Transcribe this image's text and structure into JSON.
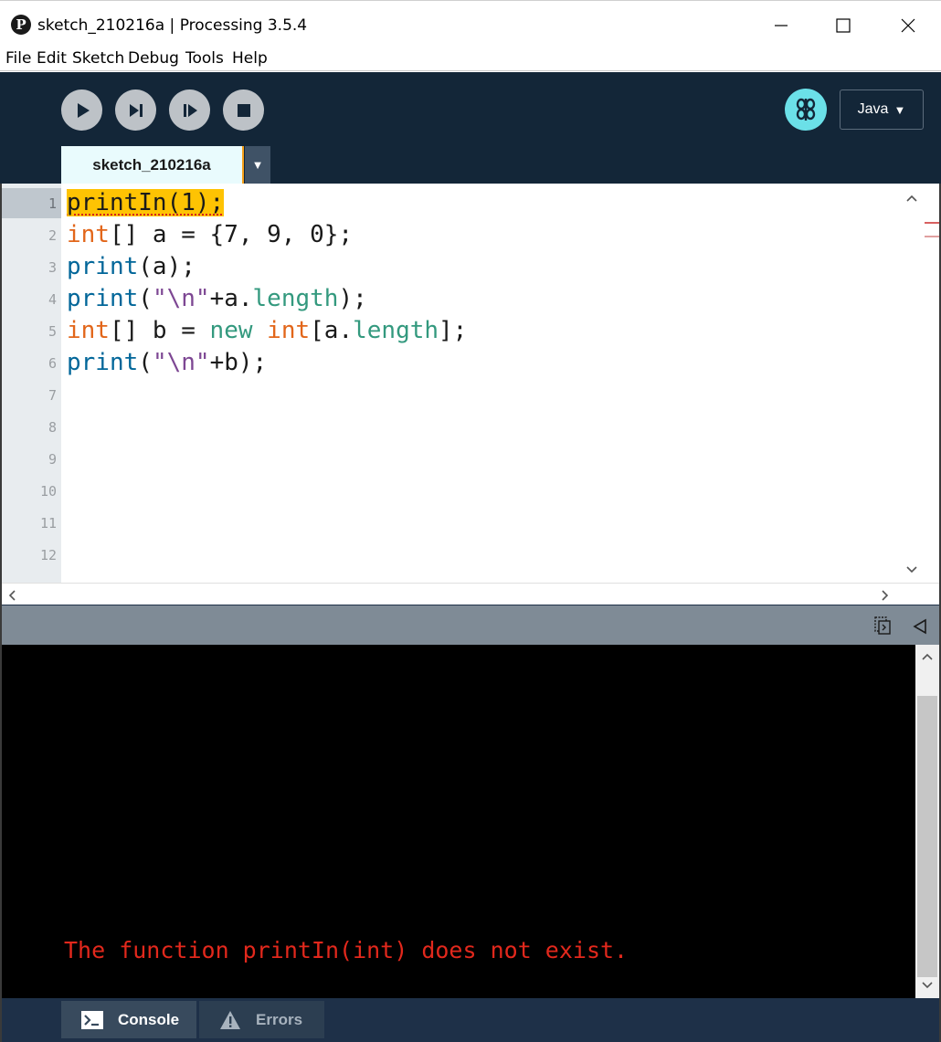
{
  "window": {
    "title": "sketch_210216a | Processing 3.5.4",
    "app_icon_glyph": "P",
    "controls": [
      "minimize-icon",
      "maximize-icon",
      "close-icon"
    ]
  },
  "menu": {
    "items": [
      "File",
      "Edit",
      "Sketch",
      "Debug",
      "Tools",
      "Help"
    ]
  },
  "toolbar": {
    "buttons": [
      "play-icon",
      "step-icon",
      "continue-icon",
      "stop-icon"
    ],
    "mode_icon": "debugger-butterfly-icon",
    "mode_label": "Java",
    "mode_arrow": "▼"
  },
  "tabs": {
    "active": "sketch_210216a",
    "menu_arrow": "▼"
  },
  "editor": {
    "line_numbers": [
      "1",
      "2",
      "3",
      "4",
      "5",
      "6",
      "7",
      "8",
      "9",
      "10",
      "11",
      "12"
    ],
    "lines": [
      [
        {
          "t": "printIn(1);",
          "c": "hl"
        }
      ],
      [
        {
          "t": "int",
          "c": "kw"
        },
        {
          "t": "[] a = {7, 9, 0};",
          "c": "plain"
        }
      ],
      [
        {
          "t": "print",
          "c": "fn"
        },
        {
          "t": "(a);",
          "c": "plain"
        }
      ],
      [
        {
          "t": "print",
          "c": "fn"
        },
        {
          "t": "(",
          "c": "plain"
        },
        {
          "t": "\"\\n\"",
          "c": "str"
        },
        {
          "t": "+a.",
          "c": "plain"
        },
        {
          "t": "length",
          "c": "prop"
        },
        {
          "t": ");",
          "c": "plain"
        }
      ],
      [
        {
          "t": "int",
          "c": "kw"
        },
        {
          "t": "[] b = ",
          "c": "plain"
        },
        {
          "t": "new",
          "c": "prop"
        },
        {
          "t": " ",
          "c": "plain"
        },
        {
          "t": "int",
          "c": "kw"
        },
        {
          "t": "[a.",
          "c": "plain"
        },
        {
          "t": "length",
          "c": "prop"
        },
        {
          "t": "];",
          "c": "plain"
        }
      ],
      [
        {
          "t": "print",
          "c": "fn"
        },
        {
          "t": "(",
          "c": "plain"
        },
        {
          "t": "\"\\n\"",
          "c": "str"
        },
        {
          "t": "+b);",
          "c": "plain"
        }
      ]
    ]
  },
  "console": {
    "message": "The function printIn(int) does not exist."
  },
  "footer": {
    "console_label": "Console",
    "errors_label": "Errors"
  },
  "colors": {
    "highlight": "#fec303",
    "keyword": "#e2661a",
    "function": "#006699",
    "string": "#7d4793",
    "property": "#33997e",
    "error_text": "#e2281c",
    "mode_icon": "#6be0e8"
  }
}
